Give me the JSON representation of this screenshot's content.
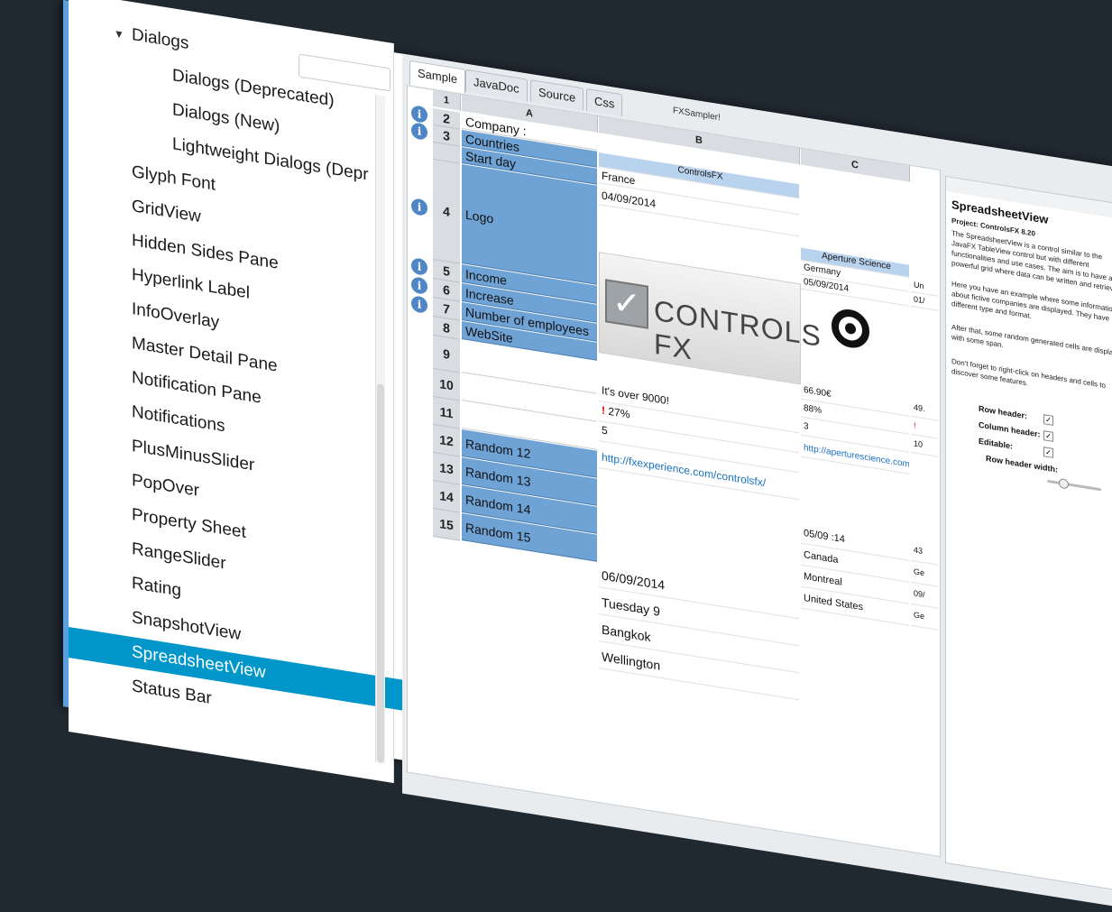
{
  "window": {
    "title": "FXSampler!"
  },
  "tree": {
    "items": [
      {
        "label": "Dialogs",
        "indent": 1,
        "expanded": true
      },
      {
        "label": "Dialogs (Deprecated)",
        "indent": 2
      },
      {
        "label": "Dialogs (New)",
        "indent": 2
      },
      {
        "label": "Lightweight Dialogs (Depr",
        "indent": 2
      },
      {
        "label": "Glyph Font",
        "indent": 1
      },
      {
        "label": "GridView",
        "indent": 1
      },
      {
        "label": "Hidden Sides Pane",
        "indent": 1
      },
      {
        "label": "Hyperlink Label",
        "indent": 1
      },
      {
        "label": "InfoOverlay",
        "indent": 1
      },
      {
        "label": "Master Detail Pane",
        "indent": 1
      },
      {
        "label": "Notification Pane",
        "indent": 1
      },
      {
        "label": "Notifications",
        "indent": 1
      },
      {
        "label": "PlusMinusSlider",
        "indent": 1
      },
      {
        "label": "PopOver",
        "indent": 1
      },
      {
        "label": "Property Sheet",
        "indent": 1
      },
      {
        "label": "RangeSlider",
        "indent": 1
      },
      {
        "label": "Rating",
        "indent": 1
      },
      {
        "label": "SnapshotView",
        "indent": 1
      },
      {
        "label": "SpreadsheetView",
        "indent": 1,
        "selected": true
      },
      {
        "label": "Status Bar",
        "indent": 1
      }
    ]
  },
  "tabs": [
    "Sample",
    "JavaDoc",
    "Source",
    "Css"
  ],
  "sheet": {
    "columns": [
      "A",
      "B",
      "C"
    ],
    "row1_num": "1",
    "rows": [
      {
        "num": "2",
        "a": "Company :",
        "info": true,
        "plain": true
      },
      {
        "num": "3",
        "a": "Countries",
        "info": true
      },
      {
        "num": "",
        "a": "Start day"
      },
      {
        "num": "4",
        "a": "Logo",
        "info": true
      },
      {
        "num": "5",
        "a": "Income",
        "info": true
      },
      {
        "num": "6",
        "a": "Increase",
        "info": true
      },
      {
        "num": "7",
        "a": "Number of employees",
        "info": true
      },
      {
        "num": "8",
        "a": "WebSite"
      },
      {
        "num": "9",
        "a": "",
        "plain": true
      },
      {
        "num": "10",
        "a": "",
        "plain": true
      },
      {
        "num": "11",
        "a": "",
        "plain": true
      },
      {
        "num": "12",
        "a": "Random 12"
      },
      {
        "num": "13",
        "a": "Random 13"
      },
      {
        "num": "14",
        "a": "Random 14"
      },
      {
        "num": "15",
        "a": "Random 15"
      }
    ],
    "col_b": {
      "company": "ControlsFX",
      "country": "France",
      "start": "04/09/2014",
      "logo_text": "CONTROLS FX",
      "increase": "It's over 9000!",
      "increase_pct": "27%",
      "employees": "5",
      "website": "http://fxexperience.com/controlsfx/",
      "r12": "06/09/2014",
      "r13": "Tuesday 9",
      "r14": "Bangkok",
      "r15": "Wellington"
    },
    "col_c": {
      "company": "Aperture Science",
      "country": "Germany",
      "start": "05/09/2014",
      "income": "66.90€",
      "increase": "88%",
      "employees": "3",
      "website": "http://aperturescience.com/",
      "r12": "05/09 :14",
      "r13": "Canada",
      "r14": "Montreal",
      "r15": "United States"
    },
    "col_d": {
      "country": "Un",
      "start": "01/",
      "income": "49.",
      "increase": "!",
      "employees": "10",
      "r12": "43",
      "r13": "Ge",
      "r14": "09/",
      "r15": "Ge"
    }
  },
  "side": {
    "title": "SpreadsheetView",
    "project": "Project: ControlsFX 8.20",
    "p1": "The SpreadsheetView is a control similar to the JavaFX TableView control but with different functionalities and use cases. The aim is to have a powerful grid where data can be written and retrieved.",
    "p2": "Here you have an example where some information about fictive companies are displayed. They have different type and format.",
    "p3": "After that, some random generated cells are displayed with some span.",
    "p4": "Don't forget to right-click on headers and cells to discover some features.",
    "options": [
      {
        "label": "Row header:",
        "checked": true
      },
      {
        "label": "Column header:",
        "checked": true
      },
      {
        "label": "Editable:",
        "checked": true
      }
    ],
    "row_header_width_label": "Row header width:",
    "row_header_width_value": 0.3
  }
}
